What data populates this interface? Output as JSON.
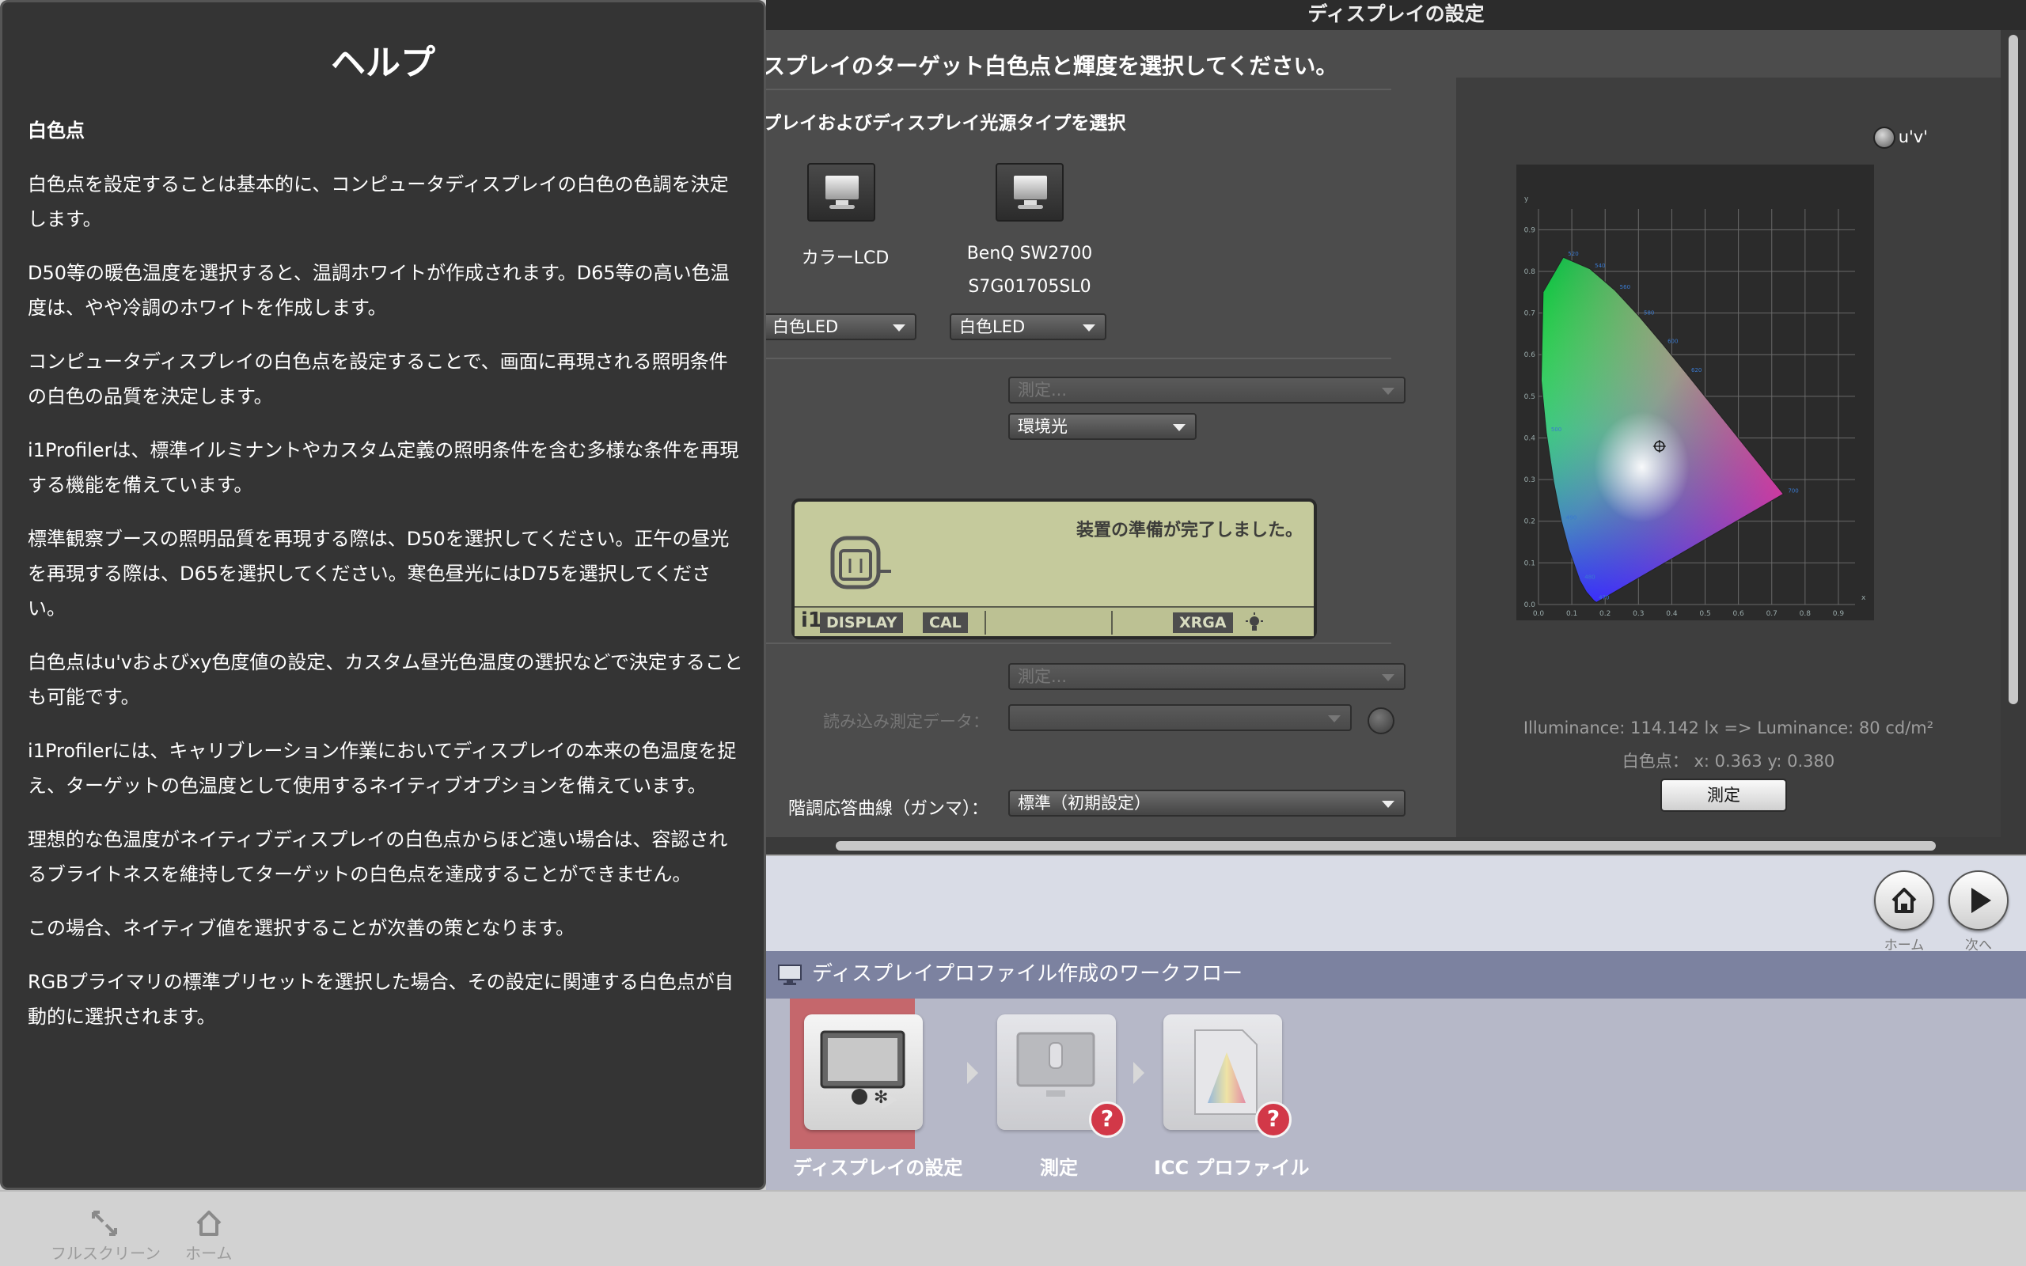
{
  "window": {
    "title": "ディスプレイの設定"
  },
  "main": {
    "heading": "スプレイのターゲット白色点と輝度を選択してください。",
    "subheading": "プレイおよびディスプレイ光源タイプを選択",
    "monitors": [
      {
        "name_line1": "カラーLCD",
        "name_line2": "",
        "light_type": "白色LED",
        "icon": "monitor-icon"
      },
      {
        "name_line1": "BenQ SW2700",
        "name_line2": "S7G01705SL0",
        "light_type": "白色LED",
        "icon": "monitor-icon"
      }
    ],
    "measure_dropdown_1": "測定...",
    "ambient_dropdown": "環境光",
    "device": {
      "status": "装置の準備が完了しました。",
      "strip": [
        "i1",
        "DISPLAY",
        "CAL",
        "XRGA"
      ],
      "icon": "bulb-icon"
    },
    "measure_dropdown_2": "測定...",
    "load_label": "読み込み測定データ：",
    "gamma_label": "階調応答曲線（ガンマ）：",
    "gamma_value": "標準（初期設定）"
  },
  "chart_panel": {
    "uv_label": "u'v'",
    "illuminance": "Illuminance:  114.142 lx  =>  Luminance:  80 cd/m²",
    "whitepoint": "白色点： x: 0.363  y: 0.380",
    "measure_button": "測定"
  },
  "chart_data": {
    "type": "scatter",
    "title": "",
    "xlabel": "x",
    "ylabel": "y",
    "xlim": [
      0,
      0.95
    ],
    "ylim": [
      0,
      0.95
    ],
    "x_ticks": [
      "0.0",
      "0.1",
      "0.2",
      "0.3",
      "0.4",
      "0.5",
      "0.6",
      "0.7",
      "0.8",
      "0.9"
    ],
    "y_ticks": [
      "0.0",
      "0.1",
      "0.2",
      "0.3",
      "0.4",
      "0.5",
      "0.6",
      "0.7",
      "0.8",
      "0.9"
    ],
    "spectral_locus_labels": [
      "520",
      "540",
      "560",
      "580",
      "600",
      "620",
      "700",
      "500",
      "490",
      "480",
      "470"
    ],
    "locus": [
      [
        0.1741,
        0.005
      ],
      [
        0.1666,
        0.0089
      ],
      [
        0.144,
        0.0297
      ],
      [
        0.1241,
        0.0578
      ],
      [
        0.0913,
        0.1327
      ],
      [
        0.0687,
        0.2007
      ],
      [
        0.0454,
        0.295
      ],
      [
        0.0235,
        0.4127
      ],
      [
        0.0082,
        0.5384
      ],
      [
        0.0139,
        0.7502
      ],
      [
        0.0743,
        0.8338
      ],
      [
        0.1547,
        0.8059
      ],
      [
        0.2296,
        0.7543
      ],
      [
        0.3016,
        0.6923
      ],
      [
        0.3731,
        0.6245
      ],
      [
        0.4441,
        0.5547
      ],
      [
        0.5125,
        0.4866
      ],
      [
        0.5752,
        0.4242
      ],
      [
        0.627,
        0.3725
      ],
      [
        0.6658,
        0.334
      ],
      [
        0.6915,
        0.3083
      ],
      [
        0.7347,
        0.2653
      ]
    ],
    "white_point": {
      "x": 0.363,
      "y": 0.38
    }
  },
  "nav": {
    "home_label": "ホーム",
    "next_label": "次へ"
  },
  "workflow": {
    "title": "ディスプレイプロファイル作成のワークフロー",
    "steps": [
      {
        "label": "ディスプレイの設定"
      },
      {
        "label": "測定"
      },
      {
        "label": "ICC プロファイル"
      }
    ],
    "qmark": "?"
  },
  "help": {
    "title": "ヘルプ",
    "section": "白色点",
    "paragraphs": [
      "白色点を設定することは基本的に、コンピュータディスプレイの白色の色調を決定します。",
      "D50等の暖色温度を選択すると、温調ホワイトが作成されます。D65等の高い色温度は、やや冷調のホワイトを作成します。",
      "コンピュータディスプレイの白色点を設定することで、画面に再現される照明条件の白色の品質を決定します。",
      "i1Profilerは、標準イルミナントやカスタム定義の照明条件を含む多様な条件を再現する機能を備えています。",
      "標準観察ブースの照明品質を再現する際は、D50を選択してください。正午の昼光を再現する際は、D65を選択してください。寒色昼光にはD75を選択してください。",
      "白色点はu'vおよびxy色度値の設定、カスタム昼光色温度の選択などで決定することも可能です。",
      "i1Profilerには、キャリブレーション作業においてディスプレイの本来の色温度を捉え、ターゲットの色温度として使用するネイティブオプションを備えています。",
      "理想的な色温度がネイティブディスプレイの白色点からほど遠い場合は、容認されるブライトネスを維持してターゲットの白色点を達成することができません。",
      "この場合、ネイティブ値を選択することが次善の策となります。",
      "RGBプライマリの標準プリセットを選択した場合、その設定に関連する白色点が自動的に選択されます。"
    ]
  },
  "bottom": {
    "fullscreen_label": "フルスクリーン",
    "home_label": "ホーム"
  }
}
